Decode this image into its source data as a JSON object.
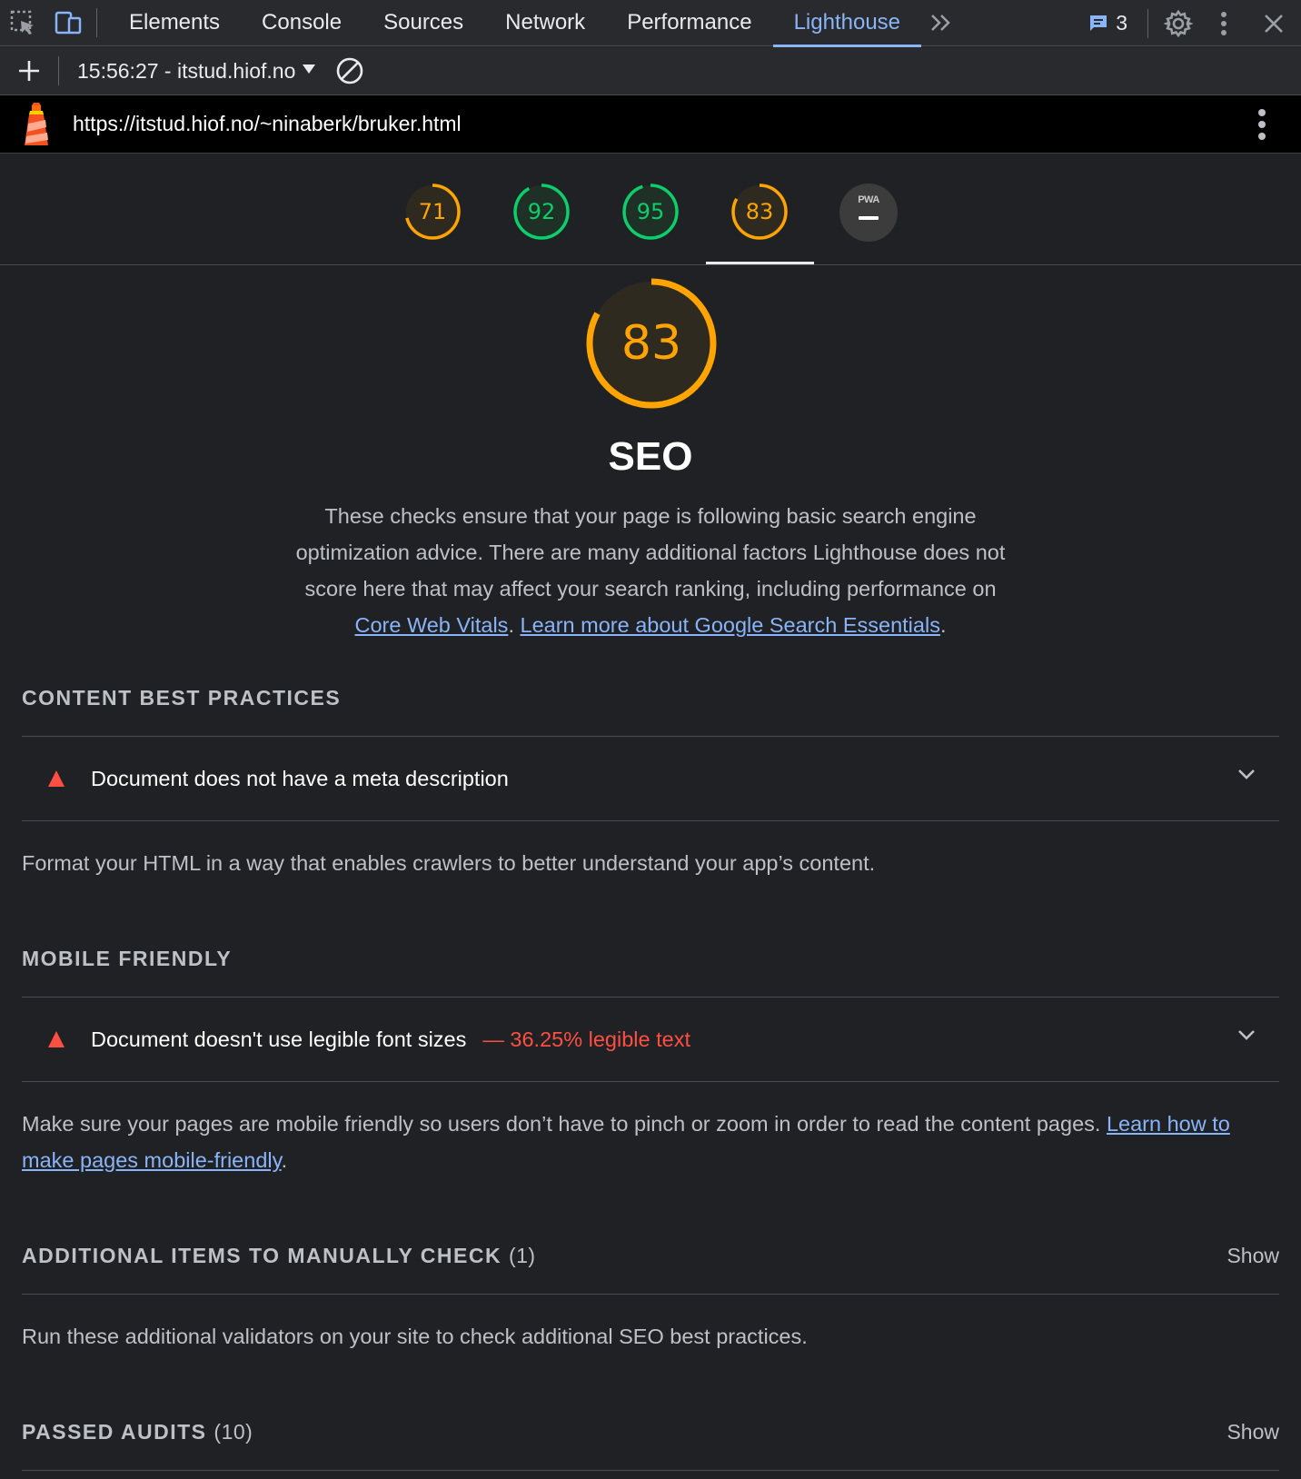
{
  "devtools": {
    "tabs": [
      {
        "label": "Elements"
      },
      {
        "label": "Console"
      },
      {
        "label": "Sources"
      },
      {
        "label": "Network"
      },
      {
        "label": "Performance"
      },
      {
        "label": "Lighthouse",
        "active": true
      }
    ],
    "issues_count": "3"
  },
  "toolbar": {
    "report_label": "15:56:27 - itstud.hiof.no"
  },
  "report": {
    "url": "https://itstud.hiof.no/~ninaberk/bruker.html",
    "gauges": [
      {
        "score": "71",
        "value": 71,
        "color": "#ffa400"
      },
      {
        "score": "92",
        "value": 92,
        "color": "#0cce6b"
      },
      {
        "score": "95",
        "value": 95,
        "color": "#0cce6b"
      },
      {
        "score": "83",
        "value": 83,
        "color": "#ffa400",
        "selected": true
      }
    ],
    "pwa_label": "PWA",
    "category": {
      "score": "83",
      "value": 83,
      "title": "SEO",
      "desc_text": "These checks ensure that your page is following basic search engine optimization advice. There are many additional factors Lighthouse does not score here that may affect your search ranking, including performance on ",
      "desc_link1": "Core Web Vitals",
      "desc_sep": ". ",
      "desc_link2": "Learn more about Google Search Essentials",
      "desc_end": "."
    },
    "groups": {
      "content": {
        "title": "CONTENT BEST PRACTICES",
        "audit_title": "Document does not have a meta description",
        "description": "Format your HTML in a way that enables crawlers to better understand your app’s content."
      },
      "mobile": {
        "title": "MOBILE FRIENDLY",
        "audit_title": "Document doesn't use legible font sizes",
        "audit_display": "— 36.25% legible text",
        "description": "Make sure your pages are mobile friendly so users don’t have to pinch or zoom in order to read the content pages. ",
        "link": "Learn how to make pages mobile-friendly",
        "end": "."
      },
      "manual": {
        "title": "ADDITIONAL ITEMS TO MANUALLY CHECK",
        "count": "(1)",
        "show": "Show",
        "description": "Run these additional validators on your site to check additional SEO best practices."
      },
      "passed": {
        "title": "PASSED AUDITS",
        "count": "(10)",
        "show": "Show"
      }
    }
  },
  "colors": {
    "accent": "#8ab4f8",
    "average": "#ffa400",
    "pass": "#0cce6b",
    "fail": "#ff4e42"
  }
}
